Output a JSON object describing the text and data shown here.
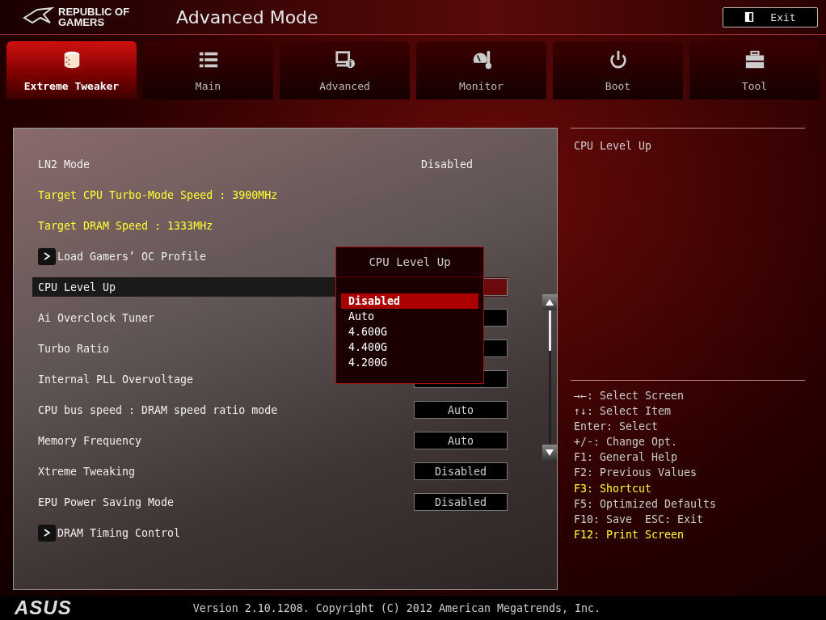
{
  "header": {
    "brand_line1": "REPUBLIC OF",
    "brand_line2": "GAMERS",
    "title": "Advanced Mode",
    "exit_label": "Exit"
  },
  "tabs": [
    {
      "label": "Extreme Tweaker",
      "selected": true
    },
    {
      "label": "Main",
      "selected": false
    },
    {
      "label": "Advanced",
      "selected": false
    },
    {
      "label": "Monitor",
      "selected": false
    },
    {
      "label": "Boot",
      "selected": false
    },
    {
      "label": "Tool",
      "selected": false
    }
  ],
  "settings": [
    {
      "kind": "value",
      "label": "LN2 Mode",
      "value": "Disabled",
      "selected": false
    },
    {
      "kind": "info",
      "label": "Target CPU Turbo-Mode Speed : 3900MHz",
      "selected": false
    },
    {
      "kind": "info",
      "label": "Target DRAM Speed : 1333MHz",
      "selected": false
    },
    {
      "kind": "submenu",
      "label": "Load Gamers’ OC Profile",
      "selected": false
    },
    {
      "kind": "select",
      "label": "CPU Level Up",
      "selected": true
    },
    {
      "kind": "select",
      "label": "Ai Overclock Tuner",
      "selected": false
    },
    {
      "kind": "select",
      "label": "Turbo Ratio",
      "selected": false
    },
    {
      "kind": "select",
      "label": "Internal PLL Overvoltage",
      "selected": false
    },
    {
      "kind": "select",
      "label": "CPU bus speed : DRAM speed ratio mode",
      "value": "Auto",
      "selected": false
    },
    {
      "kind": "select",
      "label": "Memory Frequency",
      "value": "Auto",
      "selected": false
    },
    {
      "kind": "select",
      "label": "Xtreme Tweaking",
      "value": "Disabled",
      "selected": false
    },
    {
      "kind": "select",
      "label": "EPU Power Saving Mode",
      "value": "Disabled",
      "selected": false
    },
    {
      "kind": "submenu",
      "label": "DRAM Timing Control",
      "selected": false
    }
  ],
  "popup": {
    "title": "CPU Level Up",
    "options": [
      {
        "label": "Disabled",
        "selected": true
      },
      {
        "label": "Auto",
        "selected": false
      },
      {
        "label": "4.600G",
        "selected": false
      },
      {
        "label": "4.400G",
        "selected": false
      },
      {
        "label": "4.200G",
        "selected": false
      }
    ]
  },
  "help": {
    "description": "CPU Level Up"
  },
  "key_hints": [
    {
      "text": "→←: Select Screen",
      "highlight": false
    },
    {
      "text": "↑↓: Select Item",
      "highlight": false
    },
    {
      "text": "Enter: Select",
      "highlight": false
    },
    {
      "text": "+/-: Change Opt.",
      "highlight": false
    },
    {
      "text": "F1: General Help",
      "highlight": false
    },
    {
      "text": "F2: Previous Values",
      "highlight": false
    },
    {
      "text": "F3: Shortcut",
      "highlight": true
    },
    {
      "text": "F5: Optimized Defaults",
      "highlight": false
    },
    {
      "text": "F10: Save  ESC: Exit",
      "highlight": false
    },
    {
      "text": "F12: Print Screen",
      "highlight": true
    }
  ],
  "footer": {
    "logo": "ASUS",
    "version": "Version 2.10.1208. Copyright (C) 2012 American Megatrends, Inc."
  }
}
